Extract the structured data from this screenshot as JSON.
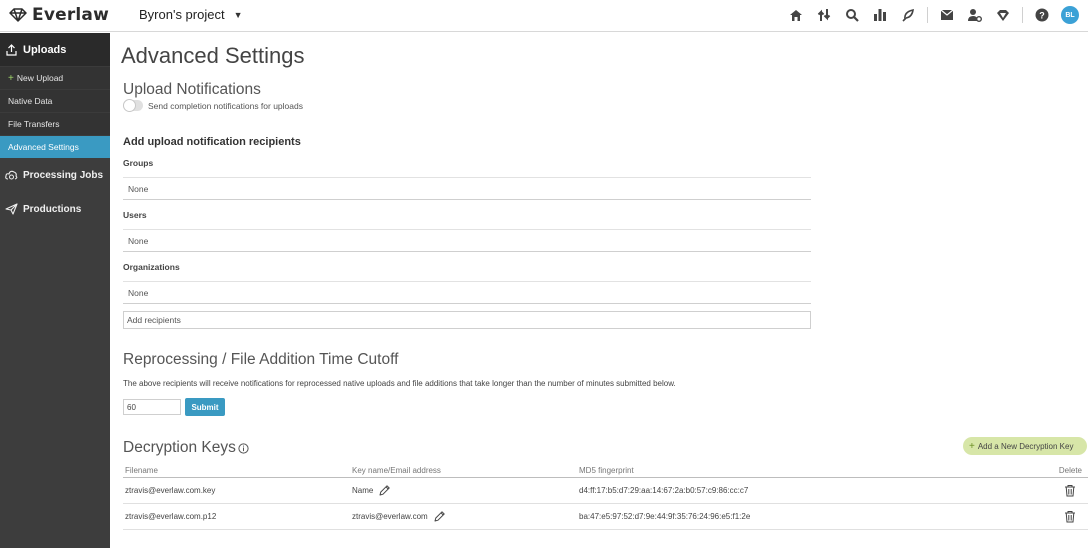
{
  "app": {
    "logo_text": "Everlaw",
    "project_name": "Byron's project",
    "avatar_initials": "BL",
    "accent_color": "#3a9ac2",
    "top_icons": [
      "home-icon",
      "transfer-icon",
      "search-icon",
      "analytics-icon",
      "storybuilder-icon",
      "messages-icon",
      "admin-user-icon",
      "legal-hold-icon",
      "help-icon"
    ]
  },
  "sidebar": {
    "section": "Uploads",
    "items": [
      {
        "label": "New Upload",
        "active": false
      },
      {
        "label": "Native Data",
        "active": false
      },
      {
        "label": "File Transfers",
        "active": false
      },
      {
        "label": "Advanced Settings",
        "active": true
      }
    ],
    "sections": [
      {
        "label": "Processing Jobs"
      },
      {
        "label": "Productions"
      }
    ]
  },
  "main": {
    "title": "Advanced Settings",
    "upload_notifications": {
      "heading": "Upload Notifications",
      "toggle_label": "Send completion notifications for uploads",
      "toggle_on": false
    },
    "recipients": {
      "heading": "Add upload notification recipients",
      "groups_label": "Groups",
      "groups_value": "None",
      "users_label": "Users",
      "users_value": "None",
      "orgs_label": "Organizations",
      "orgs_value": "None",
      "add_placeholder": "Add recipients"
    },
    "cutoff": {
      "heading": "Reprocessing / File Addition Time Cutoff",
      "note": "The above recipients will receive notifications for reprocessed native uploads and file additions that take longer than the number of minutes submitted below.",
      "minutes_value": "60",
      "submit_label": "Submit"
    },
    "decryption": {
      "heading": "Decryption Keys",
      "add_button": "Add a New Decryption Key",
      "columns": [
        "Filename",
        "Key name/Email address",
        "MD5 fingerprint",
        "Delete"
      ],
      "rows": [
        {
          "filename": "ztravis@everlaw.com.key",
          "key_name": "Name",
          "fingerprint": "d4:ff:17:b5:d7:29:aa:14:67:2a:b0:57:c9:86:cc:c7"
        },
        {
          "filename": "ztravis@everlaw.com.p12",
          "key_name": "ztravis@everlaw.com",
          "fingerprint": "ba:47:e5:97:52:d7:9e:44:9f:35:76:24:96:e5:f1:2e"
        }
      ]
    }
  }
}
